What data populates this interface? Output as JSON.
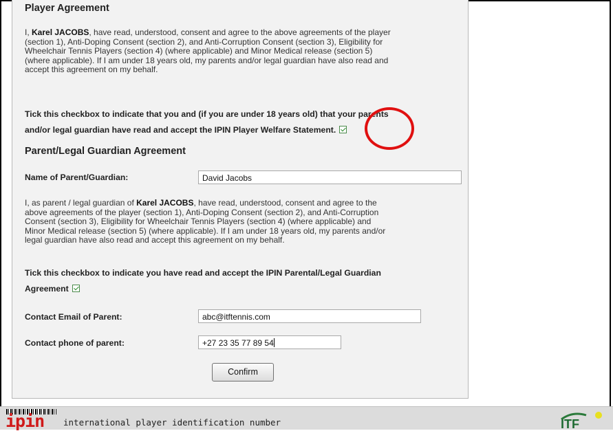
{
  "player_agreement": {
    "heading": "Player Agreement",
    "line1_pre": "I, ",
    "player_name": "Karel JACOBS",
    "line1_post": ", have read, understood, consent and agree to the above agreements of the player",
    "line2": "(section 1), Anti-Doping Consent (section 2), and Anti-Corruption Consent (section 3), Eligibility for",
    "line3": "Wheelchair Tennis Players (section 4) (where applicable) and Minor Medical release (section 5)",
    "line4": "(where applicable). If I am under 18 years old, my parents and/or legal guardian have also read and",
    "line5": "accept this agreement on my behalf.",
    "tick_line1": "Tick this checkbox to indicate that you and (if you are under 18 years old) that your parents",
    "tick_line2": "and/or legal guardian have read and accept the IPIN Player Welfare Statement.",
    "checked": true
  },
  "guardian_agreement": {
    "heading": "Parent/Legal Guardian Agreement",
    "name_label": "Name of Parent/Guardian:",
    "name_value": "David Jacobs",
    "line1_pre": "I, as parent / legal guardian of ",
    "player_name": "Karel JACOBS",
    "line1_post": ", have read, understood, consent and agree to the",
    "line2": "above agreements of the player (section 1), Anti-Doping Consent (section 2), and Anti-Corruption",
    "line3": "Consent (section 3), Eligibility for Wheelchair Tennis Players (section 4) (where applicable) and",
    "line4": "Minor Medical release (section 5) (where applicable). If I am under 18 years old, my parents and/or",
    "line5": "legal guardian have also read and accept this agreement on my behalf.",
    "tick_line1": "Tick this checkbox to indicate you have read and accept the IPIN Parental/Legal Guardian",
    "tick_line2": "Agreement",
    "checked": true,
    "email_label": "Contact Email of Parent:",
    "email_value": "abc@itftennis.com",
    "phone_label": "Contact phone of parent:",
    "phone_value": "+27 23 35 77 89 54",
    "confirm_label": "Confirm"
  },
  "footer": {
    "logo_text": "ipin",
    "tagline": "international player identification number",
    "itf_logo": "ITF"
  },
  "colors": {
    "highlight_circle": "#e01010",
    "logo_red": "#d01a1a",
    "panel_bg": "#f2f2f2"
  }
}
